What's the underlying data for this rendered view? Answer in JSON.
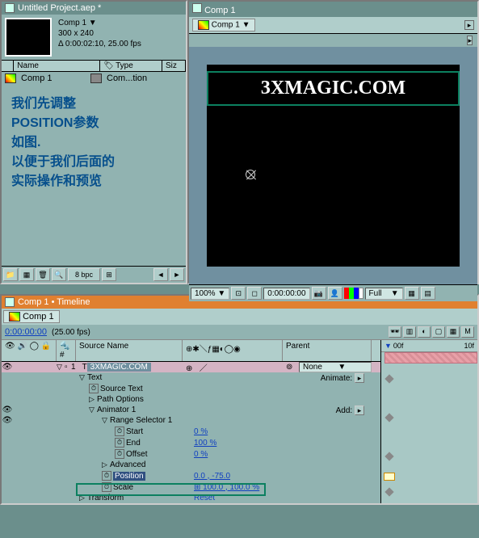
{
  "project": {
    "title": "Untitled Project.aep *",
    "comp_name": "Comp 1 ▼",
    "dimensions": "300 x 240",
    "duration": "Δ 0:00:02:10, 25.00 fps",
    "columns": {
      "name": "Name",
      "type": "Type",
      "size": "Siz"
    },
    "item_name": "Comp 1",
    "item_type": "Com...tion",
    "bpc": "8 bpc"
  },
  "annotation": {
    "line1": "我们先调整",
    "line2": "POSITION参数",
    "line3": "如图.",
    "line4": "以便于我们后面的",
    "line5": "实际操作和预览"
  },
  "viewer": {
    "title": "Comp 1",
    "tab": "Comp 1",
    "magic_text": "3XMAGIC.COM",
    "zoom": "100% ▼",
    "time": "0:00:00:00",
    "res": "Full"
  },
  "timeline": {
    "title": "Comp 1 • Timeline",
    "tab": "Comp 1",
    "timecode": "0:00:00:00",
    "fps": "(25.00 fps)",
    "ruler_0": "00f",
    "ruler_1": "10f",
    "headers": {
      "num": "#",
      "source": "Source Name",
      "parent": "Parent"
    },
    "layer": {
      "index": "1",
      "name": "3XMAGIC.COM",
      "parent": "None"
    },
    "text": "Text",
    "animate": "Animate:",
    "source_text": "Source Text",
    "path_options": "Path Options",
    "animator": "Animator 1",
    "add": "Add:",
    "range_selector": "Range Selector 1",
    "start": "Start",
    "start_val": "0 %",
    "end": "End",
    "end_val": "100 %",
    "offset": "Offset",
    "offset_val": "0 %",
    "advanced": "Advanced",
    "position": "Position",
    "position_val": "0.0 , -75.0",
    "scale": "Scale",
    "scale_val": "⊞ 100.0 , 100.0 %",
    "reset": "Reset",
    "transform": "Transform"
  }
}
